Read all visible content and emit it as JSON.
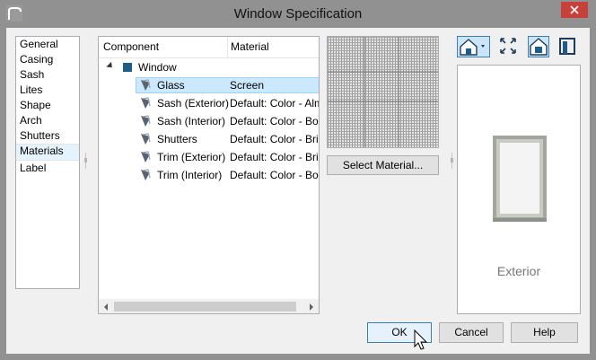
{
  "window": {
    "title": "Window Specification",
    "app_icon": "chief-architect-icon",
    "close_icon": "close-icon"
  },
  "categories": [
    {
      "label": "General",
      "selected": false
    },
    {
      "label": "Casing",
      "selected": false
    },
    {
      "label": "Sash",
      "selected": false
    },
    {
      "label": "Lites",
      "selected": false
    },
    {
      "label": "Shape",
      "selected": false
    },
    {
      "label": "Arch",
      "selected": false
    },
    {
      "label": "Shutters",
      "selected": false
    },
    {
      "label": "Materials",
      "selected": true
    },
    {
      "label": "Label",
      "selected": false
    }
  ],
  "materials_table": {
    "columns": {
      "component": "Component",
      "material": "Material"
    },
    "root": {
      "label": "Window",
      "expanded": true
    },
    "rows": [
      {
        "component": "Glass",
        "material": "Screen",
        "selected": true
      },
      {
        "component": "Sash (Exterior)",
        "material": "Default: Color - Alm",
        "selected": false
      },
      {
        "component": "Sash (Interior)",
        "material": "Default: Color - Bor",
        "selected": false
      },
      {
        "component": "Shutters",
        "material": "Default: Color - Brit",
        "selected": false
      },
      {
        "component": "Trim (Exterior)",
        "material": "Default: Color - Brit",
        "selected": false
      },
      {
        "component": "Trim (Interior)",
        "material": "Default: Color - Bor",
        "selected": false
      }
    ]
  },
  "select_material_label": "Select Material...",
  "view_toolbar": {
    "icons": [
      "camera-view-dropdown-icon",
      "fill-window-icon",
      "exterior-view-icon",
      "interior-view-icon"
    ],
    "active": "exterior-view-icon"
  },
  "preview_3d": {
    "label": "Exterior"
  },
  "buttons": {
    "ok": "OK",
    "cancel": "Cancel",
    "help": "Help"
  },
  "colors": {
    "title_bar": "#919191",
    "close": "#c7413a",
    "selection": "#cce8ff",
    "accent": "#3c7fb1",
    "window_icon": "#1e5c8a"
  }
}
